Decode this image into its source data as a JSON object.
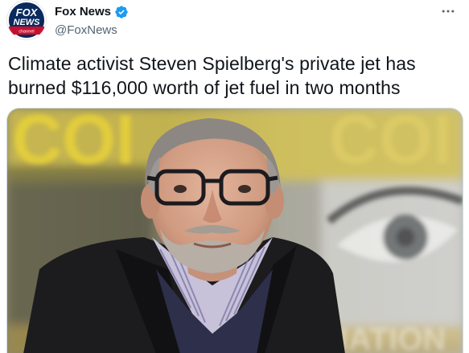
{
  "author": {
    "display_name": "Fox News",
    "handle": "@FoxNews",
    "avatar_logo_text": "FOX NEWS channel",
    "verified": true
  },
  "tweet": {
    "text_line1": "Climate activist Steven Spielberg's private jet has",
    "text_line2": "burned $116,000 worth of jet fuel in two months"
  },
  "media": {
    "icon": "photo",
    "background_lettering_top": "COI",
    "background_lettering_bottom": "NATION"
  },
  "colors": {
    "text_primary": "#0f1419",
    "text_secondary": "#536471",
    "verified_blue": "#1d9bf0",
    "fox_red": "#c8102e",
    "fox_navy": "#0a2a5e"
  }
}
